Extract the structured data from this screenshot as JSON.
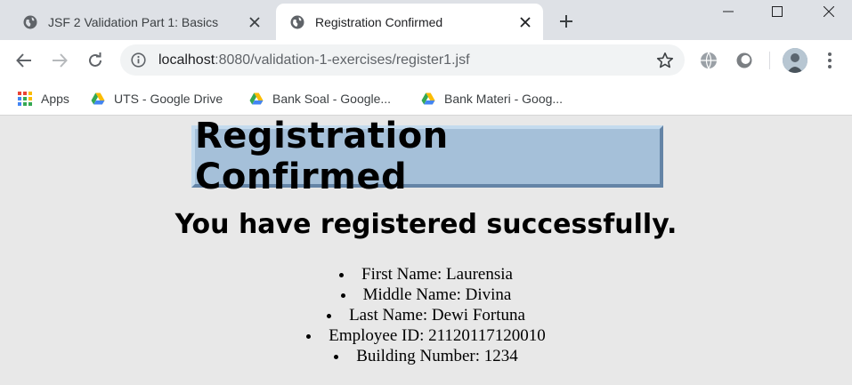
{
  "browser": {
    "tabs": [
      {
        "title": "JSF 2 Validation Part 1: Basics",
        "active": false
      },
      {
        "title": "Registration Confirmed",
        "active": true
      }
    ],
    "url": {
      "host": "localhost",
      "path": ":8080/validation-1-exercises/register1.jsf"
    },
    "bookmarks": [
      {
        "label": "Apps",
        "icon": "apps-grid-icon"
      },
      {
        "label": "UTS - Google Drive",
        "icon": "google-drive-icon"
      },
      {
        "label": "Bank Soal - Google...",
        "icon": "google-drive-icon"
      },
      {
        "label": "Bank Materi - Goog...",
        "icon": "google-drive-icon"
      }
    ]
  },
  "page": {
    "title": "Registration Confirmed",
    "message": "You have registered successfully.",
    "details": [
      "First Name: Laurensia",
      "Middle Name: Divina",
      "Last Name: Dewi Fortuna",
      "Employee ID: 21120117120010",
      "Building Number: 1234"
    ]
  },
  "colors": {
    "tabstrip": "#dee1e6",
    "title_box_bg": "#a5c0d9",
    "page_bg": "#e8e8e8"
  }
}
